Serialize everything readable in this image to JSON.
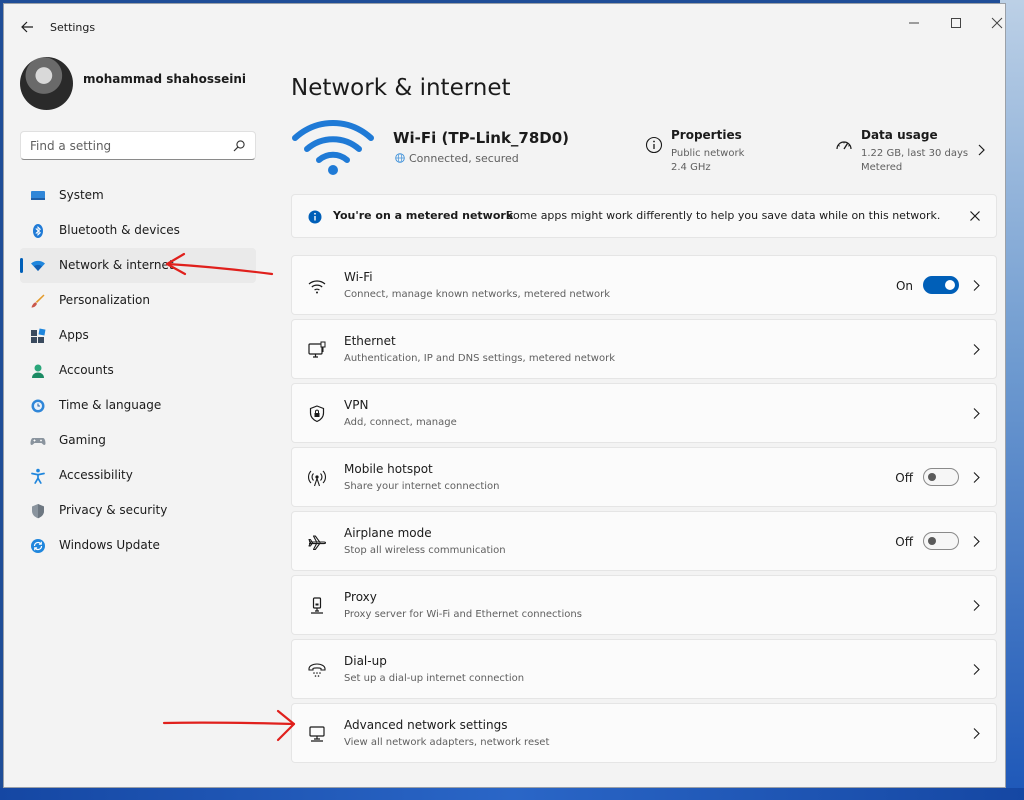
{
  "window": {
    "title": "Settings"
  },
  "user": {
    "name": "mohammad shahosseini"
  },
  "search": {
    "placeholder": "Find a setting"
  },
  "sidebar": {
    "items": [
      {
        "label": "System",
        "icon": "monitor-icon"
      },
      {
        "label": "Bluetooth & devices",
        "icon": "bluetooth-icon"
      },
      {
        "label": "Network & internet",
        "icon": "wifi-icon",
        "active": true
      },
      {
        "label": "Personalization",
        "icon": "brush-icon"
      },
      {
        "label": "Apps",
        "icon": "apps-icon"
      },
      {
        "label": "Accounts",
        "icon": "person-icon"
      },
      {
        "label": "Time & language",
        "icon": "clock-globe-icon"
      },
      {
        "label": "Gaming",
        "icon": "gamepad-icon"
      },
      {
        "label": "Accessibility",
        "icon": "accessibility-icon"
      },
      {
        "label": "Privacy & security",
        "icon": "shield-icon"
      },
      {
        "label": "Windows Update",
        "icon": "update-icon"
      }
    ]
  },
  "main": {
    "title": "Network & internet",
    "hero": {
      "name": "Wi-Fi (TP-Link_78D0)",
      "status": "Connected, secured",
      "properties": {
        "title": "Properties",
        "line1": "Public network",
        "line2": "2.4 GHz"
      },
      "data_usage": {
        "title": "Data usage",
        "line1": "1.22 GB, last 30 days",
        "line2": "Metered"
      }
    },
    "banner": {
      "title": "You're on a metered network",
      "text": "Some apps might work differently to help you save data while on this network."
    },
    "rows": [
      {
        "title": "Wi-Fi",
        "subtitle": "Connect, manage known networks, metered network",
        "state": "On",
        "icon": "wifi-icon"
      },
      {
        "title": "Ethernet",
        "subtitle": "Authentication, IP and DNS settings, metered network",
        "icon": "ethernet-icon"
      },
      {
        "title": "VPN",
        "subtitle": "Add, connect, manage",
        "icon": "vpn-shield-icon"
      },
      {
        "title": "Mobile hotspot",
        "subtitle": "Share your internet connection",
        "state": "Off",
        "icon": "hotspot-icon"
      },
      {
        "title": "Airplane mode",
        "subtitle": "Stop all wireless communication",
        "state": "Off",
        "icon": "airplane-icon"
      },
      {
        "title": "Proxy",
        "subtitle": "Proxy server for Wi-Fi and Ethernet connections",
        "icon": "proxy-icon"
      },
      {
        "title": "Dial-up",
        "subtitle": "Set up a dial-up internet connection",
        "icon": "dialup-icon"
      },
      {
        "title": "Advanced network settings",
        "subtitle": "View all network adapters, network reset",
        "icon": "advanced-network-icon"
      }
    ]
  },
  "colors": {
    "accent": "#005fb8",
    "annotation": "#e0201c"
  }
}
